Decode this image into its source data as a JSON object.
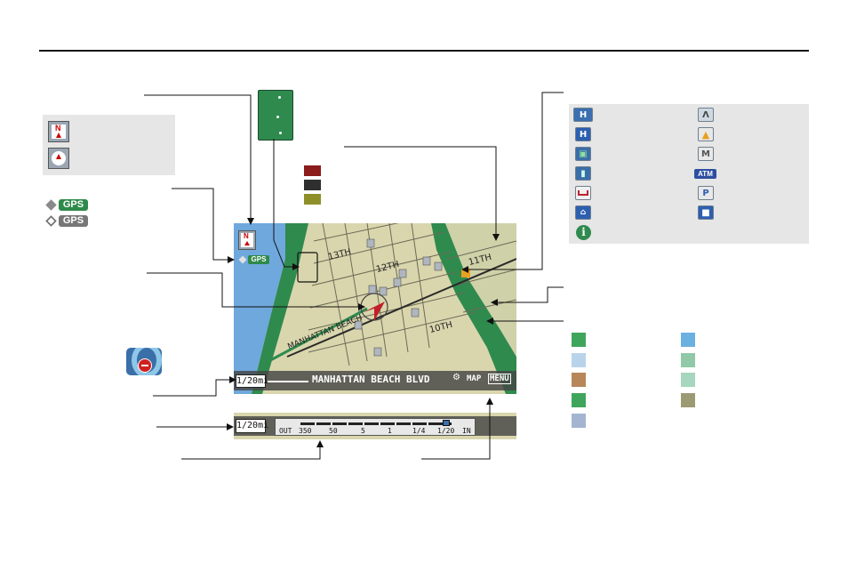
{
  "gps": {
    "label": "GPS"
  },
  "compass": {
    "north_letter": "N"
  },
  "map": {
    "scale_label": "1/20mi",
    "street_name": "MANHATTAN BEACH BLVD",
    "map_button": "MAP",
    "menu_button": "MENU",
    "street_labels": [
      "13TH",
      "12TH",
      "11TH",
      "10TH",
      "MANHATTAN BEACH"
    ]
  },
  "scale_bar": {
    "scale_label": "1/20mi",
    "ticks": [
      "OUT",
      "350",
      "50",
      "5",
      "1",
      "1/4",
      "1/20",
      "IN"
    ]
  },
  "legend_route_colors": [
    "#8b1c1c",
    "#2f2f2f",
    "#8f8f2a"
  ],
  "poi_icons": {
    "left": [
      "honda-dealer-icon",
      "hospital-icon",
      "shopping-icon",
      "gas-station-icon",
      "hotel-icon",
      "parking-garage-icon",
      "information-icon"
    ],
    "right": [
      "acura-dealer-icon",
      "school-icon",
      "historic-monument-icon",
      "atm-icon",
      "parking-lot-icon",
      "post-office-icon"
    ],
    "atm_label": "ATM",
    "parking_letter": "P",
    "hospital_letter": "H",
    "info_letter": "i"
  },
  "map_colors": {
    "left": [
      "#3fa55c",
      "#b9d3ea",
      "#b7875a",
      "#3fa55c",
      "#a3b5d0"
    ],
    "right": [
      "#6bb1e0",
      "#8fc9a8",
      "#a7d6c0",
      "#9c9a74"
    ]
  }
}
